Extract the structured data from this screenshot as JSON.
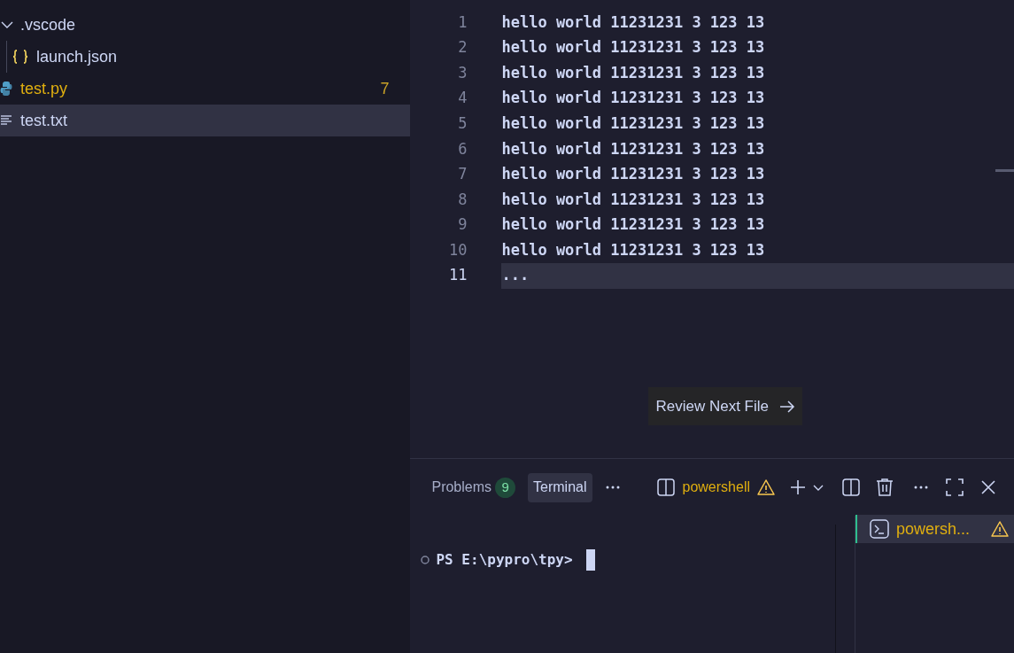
{
  "explorer": {
    "items": [
      {
        "label": ".vscode",
        "kind": "folder",
        "expanded": true,
        "selected": false,
        "warning": false,
        "children": [
          {
            "label": "launch.json",
            "kind": "json",
            "selected": false,
            "warning": false
          }
        ]
      },
      {
        "label": "test.py",
        "kind": "python",
        "selected": false,
        "warning": true,
        "badge": "7"
      },
      {
        "label": "test.txt",
        "kind": "text",
        "selected": true,
        "warning": false
      }
    ]
  },
  "editor": {
    "lines": [
      {
        "number": "1",
        "text": "hello world 11231231 3 123 13",
        "current": false
      },
      {
        "number": "2",
        "text": "hello world 11231231 3 123 13",
        "current": false
      },
      {
        "number": "3",
        "text": "hello world 11231231 3 123 13",
        "current": false
      },
      {
        "number": "4",
        "text": "hello world 11231231 3 123 13",
        "current": false
      },
      {
        "number": "5",
        "text": "hello world 11231231 3 123 13",
        "current": false
      },
      {
        "number": "6",
        "text": "hello world 11231231 3 123 13",
        "current": false
      },
      {
        "number": "7",
        "text": "hello world 11231231 3 123 13",
        "current": false
      },
      {
        "number": "8",
        "text": "hello world 11231231 3 123 13",
        "current": false
      },
      {
        "number": "9",
        "text": "hello world 11231231 3 123 13",
        "current": false
      },
      {
        "number": "10",
        "text": "hello world 11231231 3 123 13",
        "current": false
      },
      {
        "number": "11",
        "text": "...",
        "current": true
      }
    ],
    "review_button": "Review Next File"
  },
  "panel": {
    "tabs": [
      {
        "label": "Problems",
        "count": "9",
        "selected": false
      },
      {
        "label": "Terminal",
        "selected": true
      }
    ],
    "terminal_name": "powershell",
    "terminal_warning": true,
    "terminal_list": [
      {
        "label": "powersh...",
        "selected": true,
        "warning": true
      }
    ],
    "prompt": "PS E:\\pypro\\tpy>"
  }
}
